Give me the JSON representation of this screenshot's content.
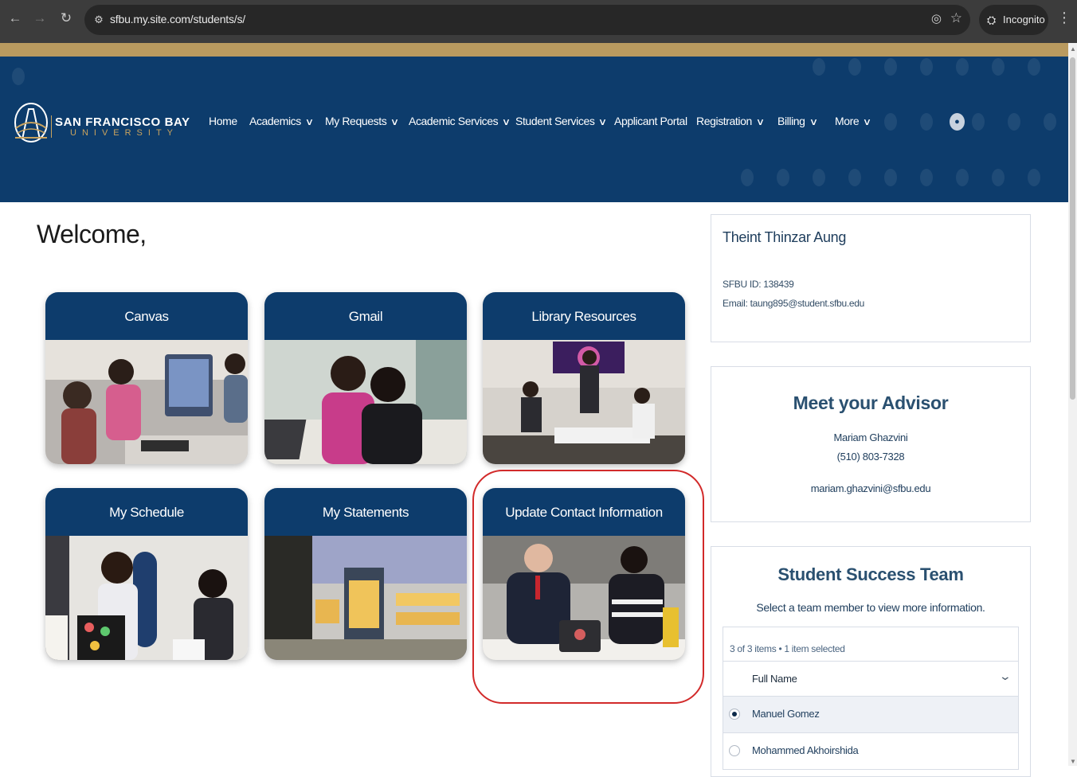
{
  "browser": {
    "url": "sfbu.my.site.com/students/s/",
    "incognito_label": "Incognito"
  },
  "logo": {
    "line1": "SAN FRANCISCO BAY",
    "line2": "UNIVERSITY"
  },
  "nav": {
    "items": [
      {
        "label": "Home",
        "has_menu": false
      },
      {
        "label": "Academics",
        "has_menu": true
      },
      {
        "label": "My Requests",
        "has_menu": true
      },
      {
        "label": "Academic Services",
        "has_menu": true
      },
      {
        "label": "Student Services",
        "has_menu": true
      },
      {
        "label": "Applicant Portal",
        "has_menu": false
      },
      {
        "label": "Registration",
        "has_menu": true
      },
      {
        "label": "Billing",
        "has_menu": true
      },
      {
        "label": "More",
        "has_menu": true
      }
    ]
  },
  "main": {
    "welcome": "Welcome,",
    "tiles": [
      {
        "label": "Canvas"
      },
      {
        "label": "Gmail"
      },
      {
        "label": "Library Resources"
      },
      {
        "label": "My Schedule"
      },
      {
        "label": "My Statements"
      },
      {
        "label": "Update Contact Information"
      }
    ]
  },
  "profile": {
    "name": "Theint Thinzar Aung",
    "id_line": "SFBU ID: 138439",
    "email_line": "Email: taung895@student.sfbu.edu"
  },
  "advisor": {
    "heading": "Meet your Advisor",
    "name": "Mariam Ghazvini",
    "phone": "(510) 803-7328",
    "email": "mariam.ghazvini@sfbu.edu"
  },
  "team": {
    "heading": "Student Success Team",
    "subheading": "Select a team member to view more information.",
    "count": "3 of 3 items • 1 item selected",
    "column_header": "Full Name",
    "rows": [
      {
        "name": "Manuel Gomez",
        "selected": true
      },
      {
        "name": "Mohammed Akhoirshida",
        "selected": false
      }
    ]
  },
  "colors": {
    "primary_navy": "#0d3c6c",
    "gold": "#b99a5f",
    "highlight_red": "#d22a2a"
  }
}
